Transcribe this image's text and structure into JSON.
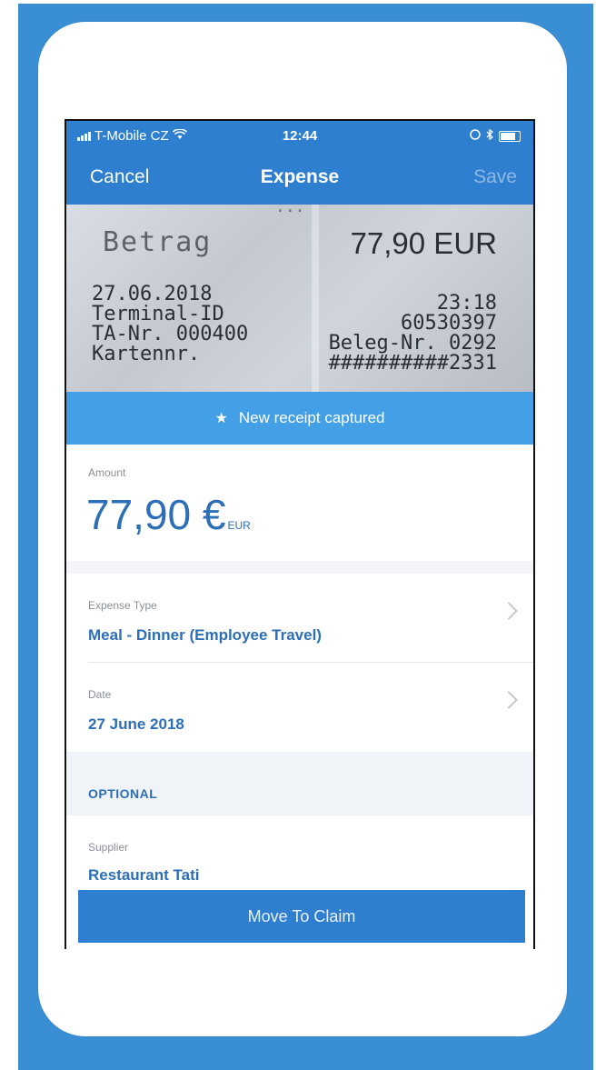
{
  "status_bar": {
    "carrier": "T-Mobile CZ",
    "time": "12:44"
  },
  "nav": {
    "cancel": "Cancel",
    "title": "Expense",
    "save": "Save"
  },
  "receipt_photo": {
    "header_text": "...",
    "betrag_label": "Betrag",
    "amount_text": "77,90 EUR",
    "date_line": "27.06.2018",
    "terminal_line": "Terminal-ID",
    "ta_line": "TA-Nr. 000400",
    "karten_line": "Kartennr.",
    "time_line": "23:18",
    "terminal_value": "60530397",
    "beleg_line": "Beleg-Nr. 0292",
    "card_line": "##########2331"
  },
  "banner": {
    "text": "New receipt captured"
  },
  "amount": {
    "label": "Amount",
    "value": "77,90 €",
    "currency": "EUR"
  },
  "expense_type": {
    "label": "Expense Type",
    "value": "Meal - Dinner (Employee Travel)"
  },
  "date": {
    "label": "Date",
    "value": "27 June 2018"
  },
  "section": {
    "optional": "OPTIONAL"
  },
  "supplier": {
    "label": "Supplier",
    "value": "Restaurant Tati"
  },
  "cta": {
    "label": "Move To Claim"
  },
  "colors": {
    "primary": "#2f7fd0",
    "banner": "#43a0e6",
    "value_text": "#2d6fb6",
    "background": "#3a8ed3"
  }
}
